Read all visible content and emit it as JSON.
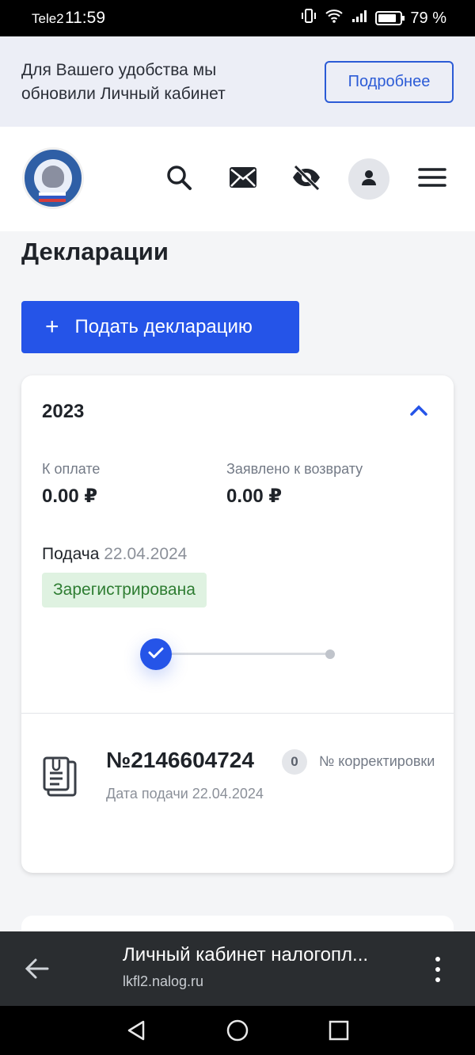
{
  "status_bar": {
    "carrier": "Tele2",
    "time": "11:59",
    "battery": "79 %",
    "battery_level": 0.79
  },
  "banner": {
    "text": "Для Вашего удобства мы обновили Личный кабинет",
    "button_label": "Подробнее"
  },
  "header": {
    "icons": [
      "search-icon",
      "mail-icon",
      "eye-off-icon",
      "profile-icon",
      "menu-icon"
    ]
  },
  "page": {
    "title": "Декларации",
    "submit_button_label": "Подать декларацию"
  },
  "declaration": {
    "year": "2023",
    "to_pay_label": "К оплате",
    "to_pay_value": "0.00 ₽",
    "refund_label": "Заявлено к возврату",
    "refund_value": "0.00 ₽",
    "submission_label": "Подача",
    "submission_date": "22.04.2024",
    "status": "Зарегистрирована",
    "progress_step": 1,
    "progress_total": 2,
    "document": {
      "number": "№2146604724",
      "correction_count": "0",
      "correction_label": "№ корректировки",
      "date_label": "Дата подачи 22.04.2024"
    }
  },
  "browser": {
    "page_title": "Личный кабинет налогопл...",
    "url": "lkfl2.nalog.ru"
  },
  "colors": {
    "accent": "#2554e8",
    "status_green_bg": "#dff2e1",
    "status_green_text": "#2e7d32",
    "banner_bg": "#eceef6"
  }
}
